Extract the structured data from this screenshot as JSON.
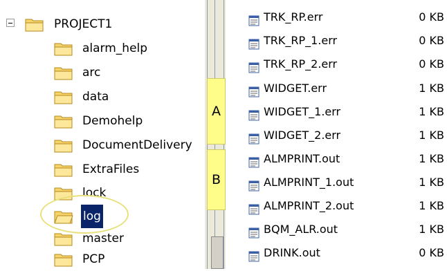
{
  "tree": {
    "root": "PROJECT1",
    "folders": [
      "alarm_help",
      "arc",
      "data",
      "Demohelp",
      "DocumentDelivery",
      "ExtraFiles",
      "lock",
      "log",
      "master",
      "PCP"
    ],
    "selected": "log"
  },
  "callouts": {
    "a": "A",
    "b": "B"
  },
  "files": [
    {
      "name": "TRK_RP.err",
      "size": "0 KB"
    },
    {
      "name": "TRK_RP_1.err",
      "size": "0 KB"
    },
    {
      "name": "TRK_RP_2.err",
      "size": "0 KB"
    },
    {
      "name": "WIDGET.err",
      "size": "1 KB"
    },
    {
      "name": "WIDGET_1.err",
      "size": "1 KB"
    },
    {
      "name": "WIDGET_2.err",
      "size": "1 KB"
    },
    {
      "name": "ALMPRINT.out",
      "size": "1 KB"
    },
    {
      "name": "ALMPRINT_1.out",
      "size": "1 KB"
    },
    {
      "name": "ALMPRINT_2.out",
      "size": "1 KB"
    },
    {
      "name": "BQM_ALR.out",
      "size": "1 KB"
    },
    {
      "name": "DRINK.out",
      "size": "0 KB"
    }
  ]
}
